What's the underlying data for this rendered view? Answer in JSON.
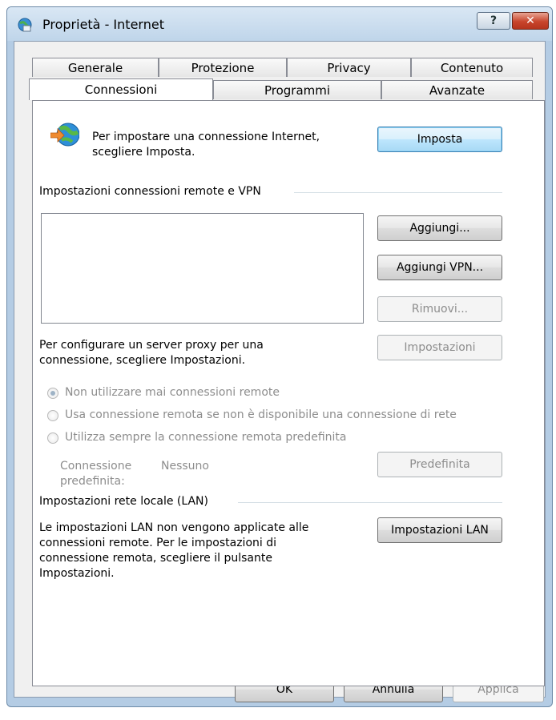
{
  "window": {
    "title": "Proprietà - Internet",
    "help_glyph": "?",
    "close_glyph": "✕"
  },
  "tabs_back": [
    "Generale",
    "Protezione",
    "Privacy",
    "Contenuto"
  ],
  "tabs_front": [
    "Connessioni",
    "Programmi",
    "Avanzate"
  ],
  "active_tab": "Connessioni",
  "setup": {
    "text_line1": "Per impostare una connessione Internet,",
    "text_line2": "scegliere Imposta.",
    "button": "Imposta"
  },
  "remote": {
    "group_label": "Impostazioni connessioni remote e VPN",
    "add_button": "Aggiungi...",
    "add_vpn_button": "Aggiungi VPN...",
    "remove_button": "Rimuovi...",
    "settings_button": "Impostazioni",
    "proxy_text_line1": "Per configurare un server proxy per una",
    "proxy_text_line2": "connessione, scegliere Impostazioni.",
    "radios": [
      {
        "label": "Non utilizzare mai connessioni remote",
        "selected": true
      },
      {
        "label": "Usa connessione remota se non è disponibile una connessione di rete",
        "selected": false
      },
      {
        "label": "Utilizza sempre la connessione remota predefinita",
        "selected": false
      }
    ],
    "default_label_line1": "Connessione",
    "default_label_line2": "predefinita:",
    "default_value": "Nessuno",
    "default_button": "Predefinita"
  },
  "lan": {
    "group_label": "Impostazioni rete locale (LAN)",
    "text_line1": "Le impostazioni LAN non vengono applicate alle",
    "text_line2": "connessioni remote. Per le impostazioni di",
    "text_line3": "connessione remota, scegliere il pulsante",
    "text_line4": "Impostazioni.",
    "button": "Impostazioni LAN"
  },
  "footer": {
    "ok": "OK",
    "cancel": "Annulla",
    "apply": "Applica"
  },
  "colors": {
    "accent": "#3c7fb1",
    "disabled_text": "#8d8d8d",
    "close_red": "#c8452c"
  }
}
